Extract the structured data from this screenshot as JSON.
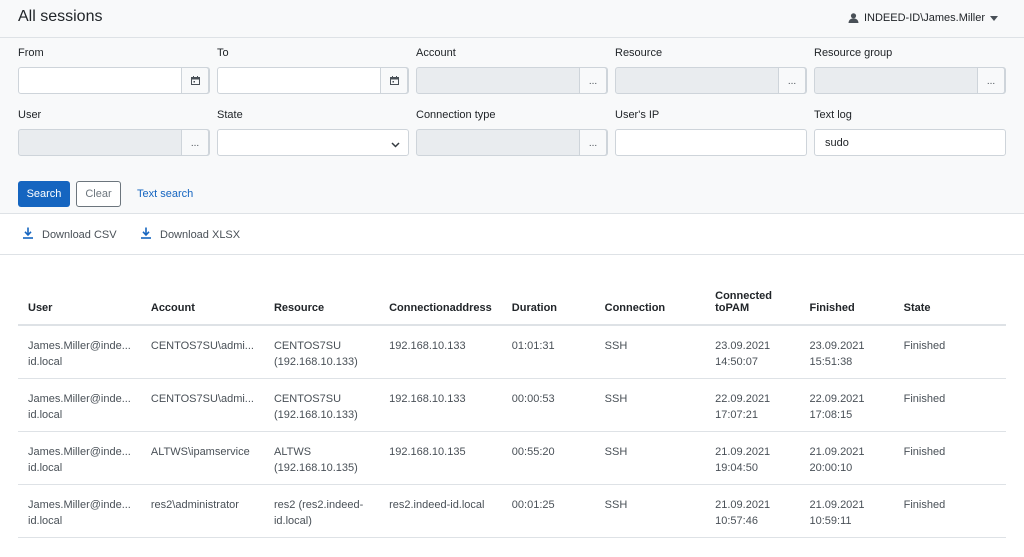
{
  "header": {
    "title": "All sessions",
    "user": "INDEED-ID\\James.Miller"
  },
  "filters": {
    "from": {
      "label": "From",
      "value": ""
    },
    "to": {
      "label": "To",
      "value": ""
    },
    "account": {
      "label": "Account",
      "value": ""
    },
    "resource": {
      "label": "Resource",
      "value": ""
    },
    "resource_group": {
      "label": "Resource group",
      "value": ""
    },
    "user": {
      "label": "User",
      "value": ""
    },
    "state": {
      "label": "State",
      "value": ""
    },
    "connection_type": {
      "label": "Connection type",
      "value": ""
    },
    "users_ip": {
      "label": "User's IP",
      "value": ""
    },
    "text_log": {
      "label": "Text log",
      "value": "sudo"
    },
    "picker_label": "..."
  },
  "actions": {
    "search": "Search",
    "clear": "Clear",
    "text_search": "Text search"
  },
  "downloads": {
    "csv": "Download CSV",
    "xlsx": "Download XLSX"
  },
  "table": {
    "headers": {
      "user": "User",
      "account": "Account",
      "resource": "Resource",
      "address_1": "Connection",
      "address_2": "address",
      "duration": "Duration",
      "connection": "Connection",
      "connected_1": "Connected to",
      "connected_2": "PAM",
      "finished": "Finished",
      "state": "State"
    },
    "rows": [
      {
        "user_1": "James.Miller@inde...",
        "user_2": "id.local",
        "account": "CENTOS7SU\\admi...",
        "resource_1": "CENTOS7SU",
        "resource_2": "(192.168.10.133)",
        "address": "192.168.10.133",
        "duration": "01:01:31",
        "connection": "SSH",
        "connected_1": "23.09.2021",
        "connected_2": "14:50:07",
        "finished_1": "23.09.2021",
        "finished_2": "15:51:38",
        "state": "Finished"
      },
      {
        "user_1": "James.Miller@inde...",
        "user_2": "id.local",
        "account": "CENTOS7SU\\admi...",
        "resource_1": "CENTOS7SU",
        "resource_2": "(192.168.10.133)",
        "address": "192.168.10.133",
        "duration": "00:00:53",
        "connection": "SSH",
        "connected_1": "22.09.2021",
        "connected_2": "17:07:21",
        "finished_1": "22.09.2021",
        "finished_2": "17:08:15",
        "state": "Finished"
      },
      {
        "user_1": "James.Miller@inde...",
        "user_2": "id.local",
        "account": "ALTWS\\ipamservice",
        "resource_1": "ALTWS",
        "resource_2": "(192.168.10.135)",
        "address": "192.168.10.135",
        "duration": "00:55:20",
        "connection": "SSH",
        "connected_1": "21.09.2021",
        "connected_2": "19:04:50",
        "finished_1": "21.09.2021",
        "finished_2": "20:00:10",
        "state": "Finished"
      },
      {
        "user_1": "James.Miller@inde...",
        "user_2": "id.local",
        "account": "res2\\administrator",
        "resource_1": "res2 (res2.indeed-",
        "resource_2": "id.local)",
        "address": "res2.indeed-id.local",
        "duration": "00:01:25",
        "connection": "SSH",
        "connected_1": "21.09.2021",
        "connected_2": "10:57:46",
        "finished_1": "21.09.2021",
        "finished_2": "10:59:11",
        "state": "Finished"
      }
    ]
  },
  "colors": {
    "accent": "#1565c0",
    "panel": "#f8f9fa",
    "disabled_field": "#e9ecef"
  },
  "icons": {
    "user": "person-icon",
    "caret": "caret-down-icon",
    "calendar": "calendar-icon",
    "download": "download-icon",
    "chevron": "chevron-down-icon"
  }
}
